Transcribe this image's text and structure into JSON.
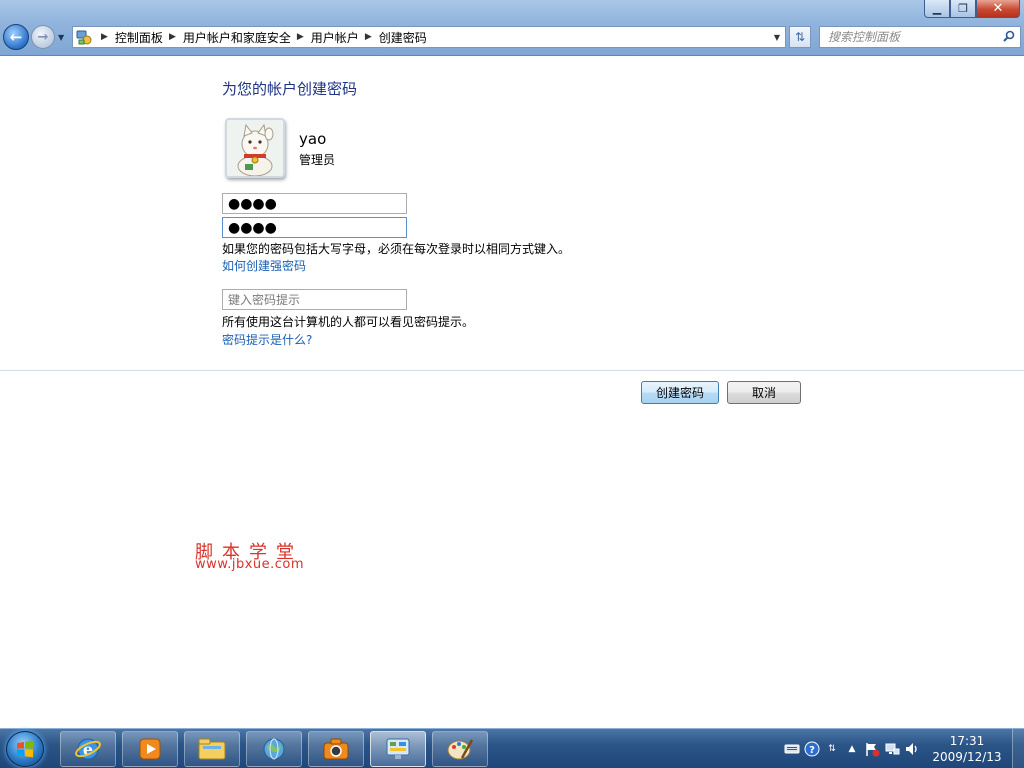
{
  "window": {
    "controls": {
      "minimize": "▁",
      "maximize": "❐",
      "close": "✕"
    }
  },
  "address_bar": {
    "crumbs": [
      "控制面板",
      "用户帐户和家庭安全",
      "用户帐户",
      "创建密码"
    ],
    "icons": {
      "location": "control-panel-icon",
      "refresh": "refresh-icon"
    }
  },
  "search": {
    "placeholder": "搜索控制面板"
  },
  "page": {
    "title": "为您的帐户创建密码",
    "user": {
      "name": "yao",
      "role": "管理员",
      "avatar": "lucky-cat-avatar"
    },
    "new_password": "●●●●",
    "confirm_password": "●●●●",
    "caps_note": "如果您的密码包括大写字母，必须在每次登录时以相同方式键入。",
    "strong_password_link": "如何创建强密码",
    "hint_placeholder": "键入密码提示",
    "hint_note": "所有使用这台计算机的人都可以看见密码提示。",
    "hint_link": "密码提示是什么?",
    "create_button": "创建密码",
    "cancel_button": "取消"
  },
  "watermark": {
    "title": "脚本学堂",
    "url": "www.jbxue.com"
  },
  "taskbar": {
    "apps": [
      "internet-explorer-icon",
      "media-player-icon",
      "file-explorer-icon",
      "network-globe-icon",
      "camera-icon",
      "control-panel-icon",
      "paint-icon"
    ],
    "time": "17:31",
    "date": "2009/12/13"
  },
  "colors": {
    "title_blue": "#1e3287",
    "link_blue": "#1a5fb4",
    "watermark_red": "#d9332b",
    "taskbar_blue": "#2b5587"
  }
}
